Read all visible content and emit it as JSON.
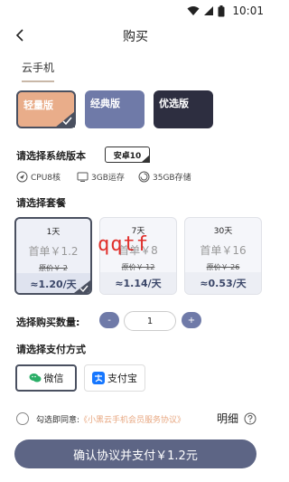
{
  "status_bar": {
    "time": "10:01"
  },
  "header": {
    "title": "购买"
  },
  "tab": {
    "label": "云手机"
  },
  "versions": [
    {
      "label": "轻量版",
      "selected": true
    },
    {
      "label": "经典版",
      "selected": false
    },
    {
      "label": "优选版",
      "selected": false
    }
  ],
  "os_section": {
    "label": "请选择系统版本",
    "selected": "安卓10",
    "specs": [
      "CPU8核",
      "3GB运存",
      "35GB存储"
    ]
  },
  "plan_section": {
    "label": "请选择套餐",
    "plans": [
      {
        "period": "1天",
        "first_price": "首单￥1.2",
        "original_price": "原价￥ 2",
        "per_day": "≈1.20/天",
        "selected": true
      },
      {
        "period": "7天",
        "first_price": "首单￥8",
        "original_price": "原价￥ 12",
        "per_day": "≈1.14/天",
        "selected": false
      },
      {
        "period": "30天",
        "first_price": "首单￥16",
        "original_price": "原价￥ 26",
        "per_day": "≈0.53/天",
        "selected": false
      }
    ]
  },
  "watermark": "qqtf",
  "quantity_section": {
    "label": "选择购买数量:",
    "minus": "-",
    "plus": "+",
    "value": "1"
  },
  "payment_section": {
    "label": "请选择支付方式",
    "wechat": "微信",
    "alipay": "支付宝"
  },
  "agreement": {
    "prefix": "勾选即同意:",
    "link": "《小黑云手机会员服务协议》"
  },
  "detail_label": "明细",
  "pay_button": "确认协议并支付￥1.2元",
  "colors": {
    "accent": "#5d6585",
    "selected_version": "#e9ad8a",
    "classic": "#6f7aa8",
    "premium": "#2d2e40",
    "link": "#e8a882"
  }
}
